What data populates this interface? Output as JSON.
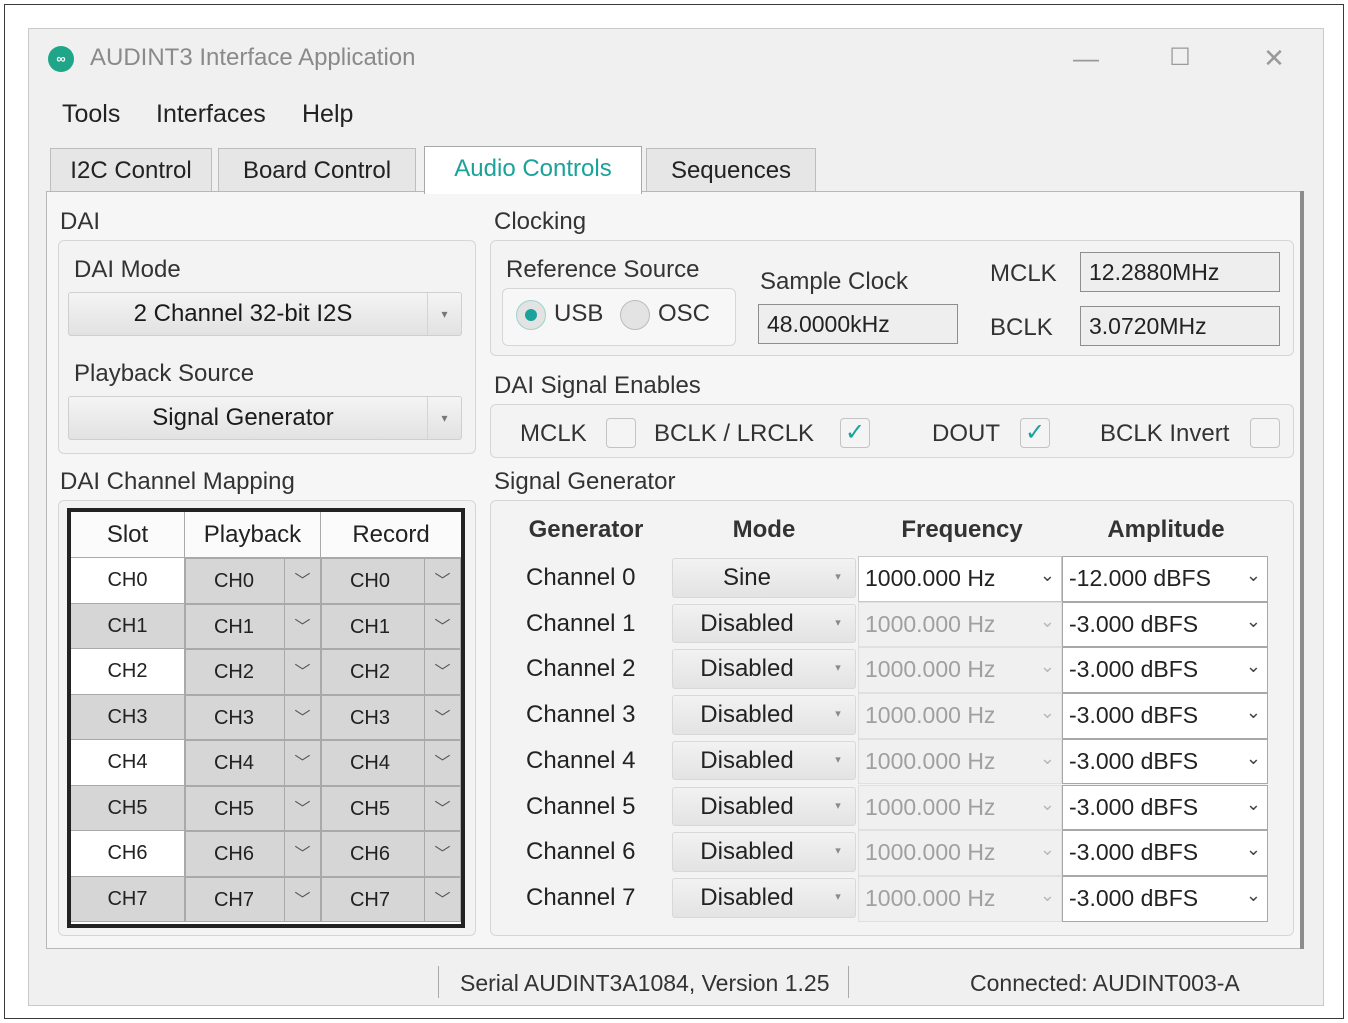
{
  "window": {
    "logo": "∞",
    "title": "AUDINT3 Interface Application",
    "minimize": "—",
    "maximize": "☐",
    "close": "✕"
  },
  "menu": [
    "Tools",
    "Interfaces",
    "Help"
  ],
  "tabs": [
    {
      "label": "I2C Control",
      "active": false
    },
    {
      "label": "Board Control",
      "active": false
    },
    {
      "label": "Audio Controls",
      "active": true
    },
    {
      "label": "Sequences",
      "active": false
    }
  ],
  "dai": {
    "section": "DAI",
    "mode_label": "DAI Mode",
    "mode_value": "2 Channel 32-bit I2S",
    "playback_label": "Playback Source",
    "playback_value": "Signal Generator"
  },
  "clocking": {
    "section": "Clocking",
    "ref_label": "Reference Source",
    "usb_label": "USB",
    "osc_label": "OSC",
    "selected": "USB",
    "sample_clock_label": "Sample Clock",
    "sample_clock_value": "48.0000kHz",
    "mclk_label": "MCLK",
    "mclk_value": "12.2880MHz",
    "bclk_label": "BCLK",
    "bclk_value": "3.0720MHz"
  },
  "signal_enables": {
    "section": "DAI Signal Enables",
    "items": [
      {
        "label": "MCLK",
        "checked": false
      },
      {
        "label": "BCLK / LRCLK",
        "checked": true
      },
      {
        "label": "DOUT",
        "checked": true
      },
      {
        "label": "BCLK Invert",
        "checked": false
      }
    ],
    "check_glyph": "✓"
  },
  "mapping": {
    "section": "DAI Channel Mapping",
    "headers": [
      "Slot",
      "Playback",
      "Record"
    ],
    "arrow": "﹀",
    "rows": [
      {
        "slot": "CH0",
        "playback": "CH0",
        "record": "CH0"
      },
      {
        "slot": "CH1",
        "playback": "CH1",
        "record": "CH1"
      },
      {
        "slot": "CH2",
        "playback": "CH2",
        "record": "CH2"
      },
      {
        "slot": "CH3",
        "playback": "CH3",
        "record": "CH3"
      },
      {
        "slot": "CH4",
        "playback": "CH4",
        "record": "CH4"
      },
      {
        "slot": "CH5",
        "playback": "CH5",
        "record": "CH5"
      },
      {
        "slot": "CH6",
        "playback": "CH6",
        "record": "CH6"
      },
      {
        "slot": "CH7",
        "playback": "CH7",
        "record": "CH7"
      }
    ]
  },
  "generator": {
    "section": "Signal Generator",
    "headers": [
      "Generator",
      "Mode",
      "Frequency",
      "Amplitude"
    ],
    "combo_arrow": "▾",
    "field_arrow": "⌄",
    "rows": [
      {
        "channel": "Channel 0",
        "mode": "Sine",
        "frequency": "1000.000 Hz",
        "amplitude": "-12.000 dBFS",
        "enabled": true
      },
      {
        "channel": "Channel 1",
        "mode": "Disabled",
        "frequency": "1000.000 Hz",
        "amplitude": "-3.000 dBFS",
        "enabled": false
      },
      {
        "channel": "Channel 2",
        "mode": "Disabled",
        "frequency": "1000.000 Hz",
        "amplitude": "-3.000 dBFS",
        "enabled": false
      },
      {
        "channel": "Channel 3",
        "mode": "Disabled",
        "frequency": "1000.000 Hz",
        "amplitude": "-3.000 dBFS",
        "enabled": false
      },
      {
        "channel": "Channel 4",
        "mode": "Disabled",
        "frequency": "1000.000 Hz",
        "amplitude": "-3.000 dBFS",
        "enabled": false
      },
      {
        "channel": "Channel 5",
        "mode": "Disabled",
        "frequency": "1000.000 Hz",
        "amplitude": "-3.000 dBFS",
        "enabled": false
      },
      {
        "channel": "Channel 6",
        "mode": "Disabled",
        "frequency": "1000.000 Hz",
        "amplitude": "-3.000 dBFS",
        "enabled": false
      },
      {
        "channel": "Channel 7",
        "mode": "Disabled",
        "frequency": "1000.000 Hz",
        "amplitude": "-3.000 dBFS",
        "enabled": false
      }
    ]
  },
  "status": {
    "serial": "Serial AUDINT3A1084, Version 1.25",
    "connection": "Connected: AUDINT003-A"
  },
  "colors": {
    "accent": "#1aa39a",
    "logo": "#1fa688"
  }
}
